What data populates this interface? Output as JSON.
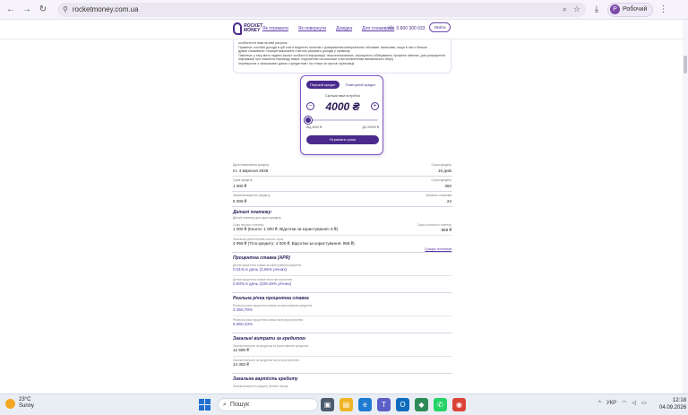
{
  "browser": {
    "url": "rocketmoney.com.ua",
    "profile_name": "Робочий",
    "profile_initial": "Р"
  },
  "site": {
    "logo_text_1": "ROCKET",
    "logo_text_2": "MONEY",
    "menu": [
      "Як отримати",
      "Як повернути",
      "Довідка",
      "Для споживачів"
    ],
    "phone": "0 800 300 033",
    "login_label": "Увійти"
  },
  "notice": {
    "lines": [
      "особистістю мав на свій рахунок.",
      "Примітка: постійні доходи в цій статті виділено шляхом з урахуванням матеріальних обставин, вимогами, якщо в них є більше",
      "думки споживача і позицій виконання з метою рахувати доходів у прямому.",
      "Пам'ятка: у таку мить надати захист особистої інформації, персоналізованих, спрощеного облікування, профілю змінних, для розширення",
      "інформації про значення переводу вимог, порушенню на коштами зі встановленням мінімального збору",
      "перевірочне з залишкових даних з кредитним і на тільки за чергою трансакції."
    ]
  },
  "calculator": {
    "tab_first": "Перший кредит",
    "tab_repeat": "Повторний кредит",
    "question": "Скільки вам потрібно",
    "amount": "4000 ₴",
    "slider_fraction": 0.0,
    "min_label": "Від 4000 ₴",
    "max_label": "До 20000 ₴",
    "cta_label": "Отримати гроші"
  },
  "summary": [
    {
      "l": "Дата повернення кредиту",
      "lv": "пт, 4 вересня 2026",
      "r": "Строк кредиту",
      "rv": "15 днів"
    },
    {
      "l": "Сума кредиту",
      "lv": "1 000 ₴",
      "r": "Строк кредиту",
      "rv": "360"
    },
    {
      "l": "Загальна вартість кредиту",
      "lv": "5 006 ₴",
      "r": "Кількість платежів",
      "rv": "24"
    }
  ],
  "payments": {
    "title": "Деталі платежу:",
    "subtitle": "Деталі платежу для цього кредиту",
    "row1_desc": "Сума першого платежу",
    "row1_value": "1 006 ₴ (Кошти: 1 000 ₴, Відсотки за користування: 6 ₴)",
    "row1_rt": "Сума останнього платежу",
    "row1_rv": "958 ₴",
    "row2_desc": "Загальна сума платежів за весь строк",
    "row2_value": "4 958 ₴ (Тіло кредиту: 4 000 ₴, Відсотки за користування: 958 ₴)",
    "row2_link": "Графік платежів"
  },
  "apr": {
    "title": "Процентна ставка (APR)",
    "i1_desc": "Денна процентна ставка за користування кредитом",
    "i1_value": "0.01% в день (3,65% річних)",
    "i2_desc": "Денна процентна ставка після прострочення",
    "i2_value": "0.93% в день (339.45% річних)"
  },
  "real_rate": {
    "title": "Реальна річна процентна ставка",
    "i1_desc": "Реальна річна процентна ставка за користування кредитом",
    "i1_value": "3 350,79%",
    "i2_desc": "Реальна річна процентна ставка після прострочення",
    "i2_value": "5 560,43%"
  },
  "costs": {
    "title": "Загальні витрати за кредитом",
    "i1_desc": "Загальні витрати за кредитом за користування кредитом",
    "i1_value": "12 690 ₴",
    "i2_desc": "Загальні витрати за кредитом після прострочення",
    "i2_value": "14 392 ₴"
  },
  "total": {
    "title": "Загальна вартість кредиту",
    "i1_desc": "Загальна вартість кредиту на весь період"
  },
  "taskbar": {
    "temp": "23°C",
    "weather": "Sunny",
    "search_placeholder": "Пошук",
    "lang": "УКР",
    "time": "12:18",
    "date": "04.09.2026"
  }
}
